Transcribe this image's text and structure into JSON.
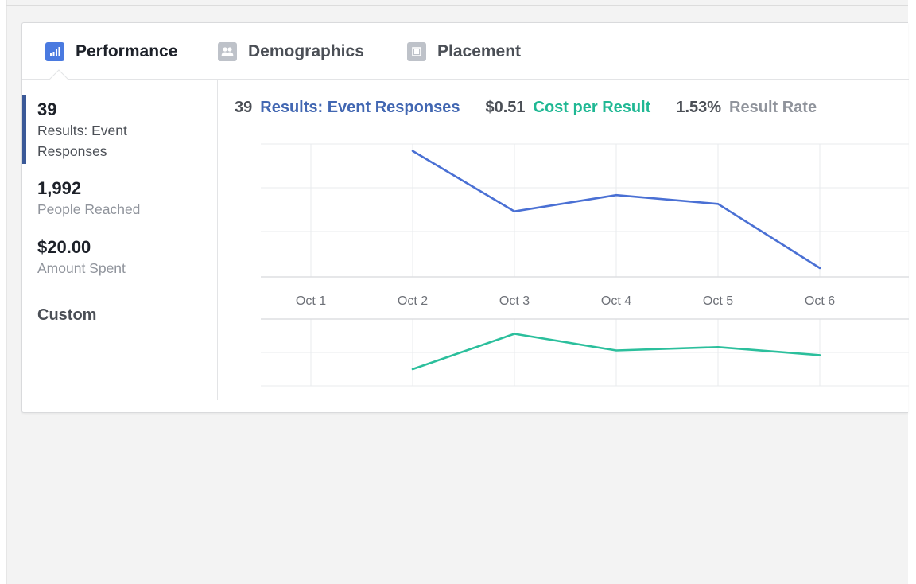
{
  "tabs": {
    "performance": "Performance",
    "demographics": "Demographics",
    "placement": "Placement"
  },
  "stats": [
    {
      "value": "39",
      "label_line1": "Results: Event",
      "label_line2": "Responses"
    },
    {
      "value": "1,992",
      "label": "People Reached"
    },
    {
      "value": "$20.00",
      "label": "Amount Spent"
    }
  ],
  "custom_label": "Custom",
  "metrics": {
    "results_value": "39",
    "results_label": "Results: Event Responses",
    "cost_value": "$0.51",
    "cost_label": "Cost per Result",
    "rate_value": "1.53%",
    "rate_label": "Result Rate"
  },
  "colors": {
    "results": "#4a70d4",
    "cost": "#2bbf9c",
    "accent_bar": "#3b5998"
  },
  "chart_data": [
    {
      "type": "line",
      "categories": [
        "Oct 1",
        "Oct 2",
        "Oct 3",
        "Oct 4",
        "Oct 5",
        "Oct 6"
      ],
      "series": [
        {
          "name": "Results: Event Responses",
          "values": [
            null,
            1.0,
            0.52,
            0.65,
            0.58,
            0.07
          ]
        }
      ],
      "ylim": [
        0,
        1.1
      ],
      "grid": true
    },
    {
      "type": "line",
      "categories": [
        "Oct 1",
        "Oct 2",
        "Oct 3",
        "Oct 4",
        "Oct 5",
        "Oct 6"
      ],
      "series": [
        {
          "name": "Cost per Result",
          "values": [
            null,
            0.25,
            0.78,
            0.53,
            0.58,
            0.46
          ]
        }
      ],
      "ylim": [
        0,
        1.0
      ],
      "grid": true
    }
  ]
}
